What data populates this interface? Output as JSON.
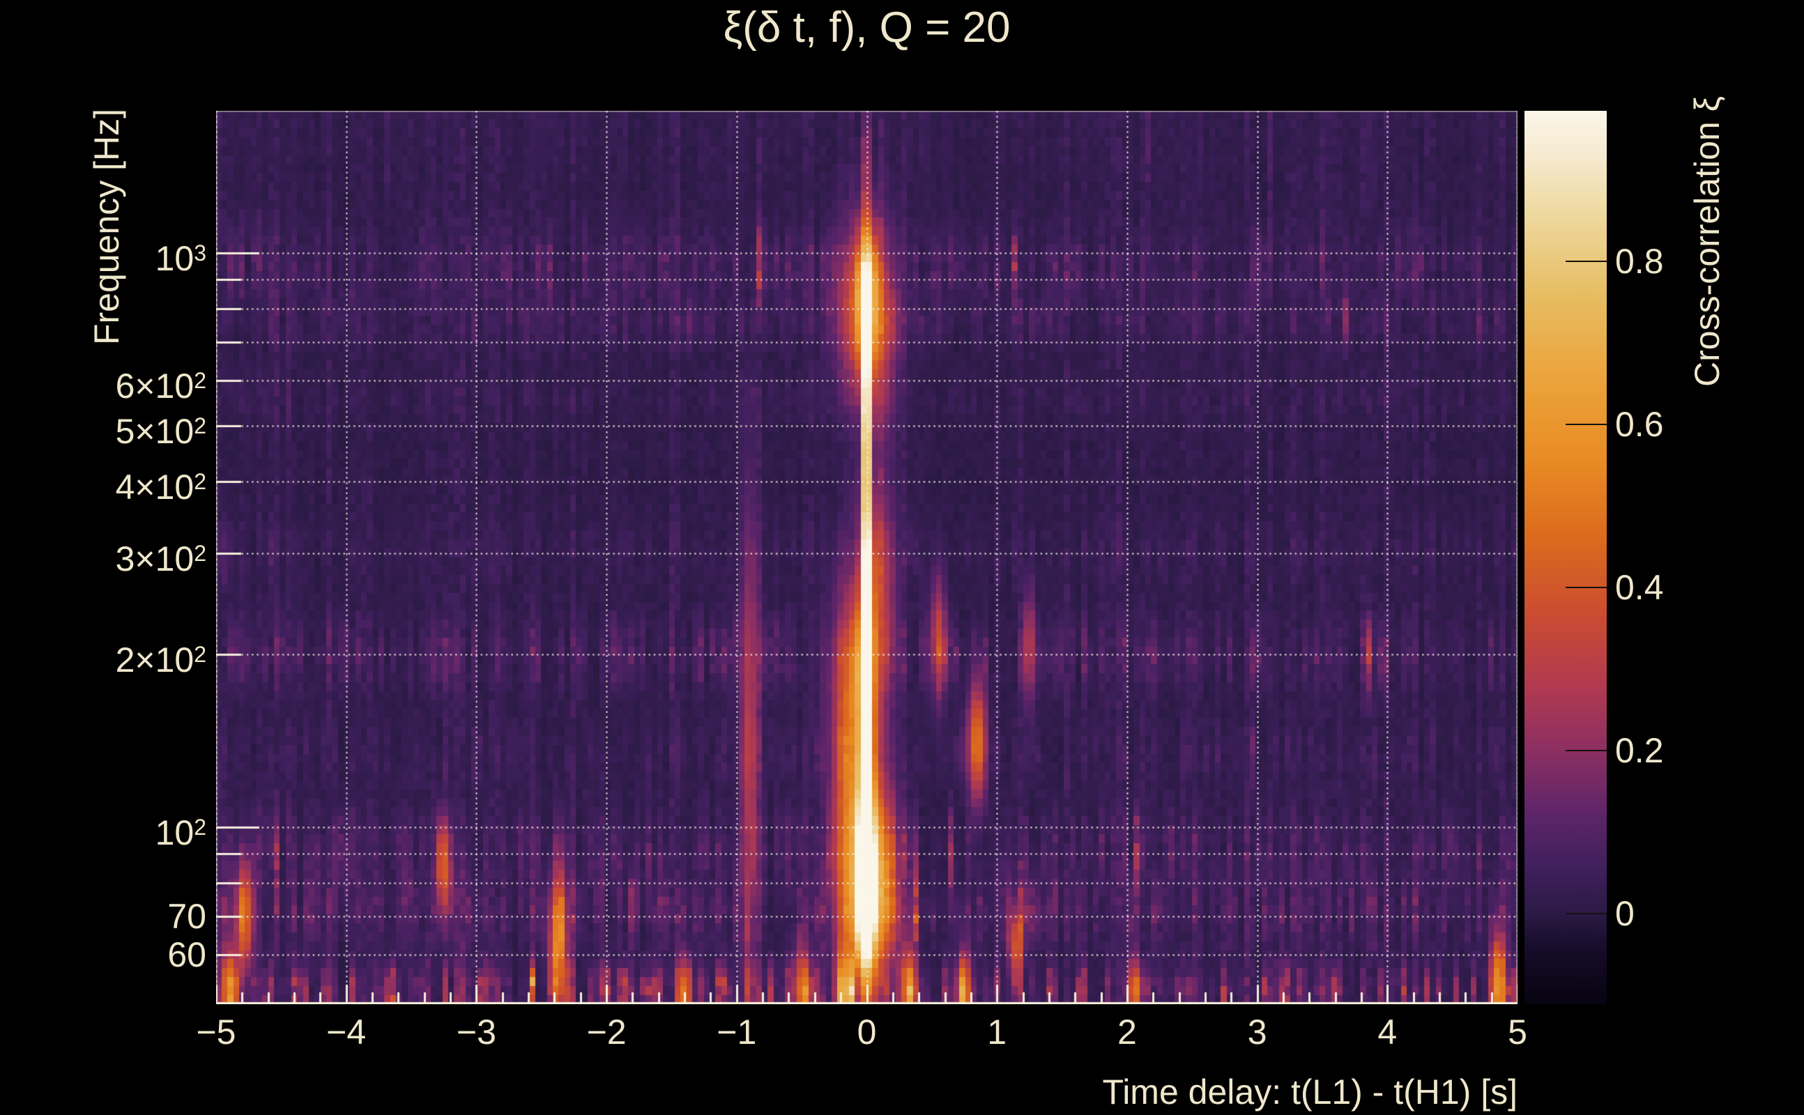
{
  "chart_data": {
    "type": "heatmap",
    "title": "ξ(δ t, f), Q = 20",
    "xlabel": "Time delay: t(L1) - t(H1) [s]",
    "ylabel": "Frequency [Hz]",
    "colorbar_label": "Cross-correlation ξ",
    "x_range": [
      -5,
      5
    ],
    "x_ticks": [
      {
        "v": -5,
        "label": "−5"
      },
      {
        "v": -4,
        "label": "−4"
      },
      {
        "v": -3,
        "label": "−3"
      },
      {
        "v": -2,
        "label": "−2"
      },
      {
        "v": -1,
        "label": "−1"
      },
      {
        "v": 0,
        "label": "0"
      },
      {
        "v": 1,
        "label": "1"
      },
      {
        "v": 2,
        "label": "2"
      },
      {
        "v": 3,
        "label": "3"
      },
      {
        "v": 4,
        "label": "4"
      },
      {
        "v": 5,
        "label": "5"
      }
    ],
    "x_minor_tick_step": 0.2,
    "y_scale": "log",
    "y_range_hz": [
      49.2,
      1768
    ],
    "y_ticks": [
      {
        "text": "10",
        "sup": "3",
        "f": 1000
      },
      {
        "text": "6×10",
        "sup": "2",
        "f": 600
      },
      {
        "text": "5×10",
        "sup": "2",
        "f": 500
      },
      {
        "text": "4×10",
        "sup": "2",
        "f": 400
      },
      {
        "text": "3×10",
        "sup": "2",
        "f": 300
      },
      {
        "text": "2×10",
        "sup": "2",
        "f": 200
      },
      {
        "text": "10",
        "sup": "2",
        "f": 100
      },
      {
        "text": "70",
        "sup": "",
        "f": 70
      },
      {
        "text": "60",
        "sup": "",
        "f": 60
      }
    ],
    "y_gridline_freqs": [
      1000,
      900,
      800,
      700,
      600,
      500,
      400,
      300,
      200,
      100,
      90,
      80,
      70,
      60
    ],
    "grid": "dotted",
    "colorbar": {
      "min": -0.111,
      "max": 0.985,
      "ticks": [
        {
          "v": 0.8,
          "label": "0.8"
        },
        {
          "v": 0.6,
          "label": "0.6"
        },
        {
          "v": 0.4,
          "label": "0.4"
        },
        {
          "v": 0.2,
          "label": "0.2"
        },
        {
          "v": 0.0,
          "label": "0"
        }
      ],
      "stops": [
        {
          "v": -0.111,
          "c": "#070310"
        },
        {
          "v": -0.04,
          "c": "#170d2c"
        },
        {
          "v": 0.0,
          "c": "#2b1a45"
        },
        {
          "v": 0.06,
          "c": "#41205e"
        },
        {
          "v": 0.12,
          "c": "#5c2469"
        },
        {
          "v": 0.2,
          "c": "#8c2f62"
        },
        {
          "v": 0.28,
          "c": "#b13a50"
        },
        {
          "v": 0.36,
          "c": "#c94a33"
        },
        {
          "v": 0.46,
          "c": "#dc6a1d"
        },
        {
          "v": 0.56,
          "c": "#e98c25"
        },
        {
          "v": 0.66,
          "c": "#eba43c"
        },
        {
          "v": 0.76,
          "c": "#e7bd63"
        },
        {
          "v": 0.86,
          "c": "#eed9a0"
        },
        {
          "v": 0.93,
          "c": "#f6ead0"
        },
        {
          "v": 0.985,
          "c": "#fbf6ea"
        }
      ]
    },
    "peak": {
      "time_delay_s": 0.0,
      "max_cross_correlation": 0.985,
      "freq_span_hz": [
        50,
        1600
      ]
    },
    "features": [
      {
        "t": 0.0,
        "f": 72,
        "a": 0.95,
        "dt": 0.055,
        "dl": 0.09
      },
      {
        "t": 0.0,
        "f": 100,
        "a": 0.9,
        "dt": 0.045,
        "dl": 0.1
      },
      {
        "t": 0.0,
        "f": 170,
        "a": 0.85,
        "dt": 0.035,
        "dl": 0.1
      },
      {
        "t": 0.0,
        "f": 270,
        "a": 0.8,
        "dt": 0.028,
        "dl": 0.1
      },
      {
        "t": 0.0,
        "f": 420,
        "a": 0.78,
        "dt": 0.022,
        "dl": 0.1
      },
      {
        "t": 0.0,
        "f": 560,
        "a": 0.72,
        "dt": 0.02,
        "dl": 0.08
      },
      {
        "t": 0.0,
        "f": 810,
        "a": 0.73,
        "dt": 0.045,
        "dl": 0.08
      },
      {
        "t": 0.0,
        "f": 1050,
        "a": 0.4,
        "dt": 0.015,
        "dl": 0.08
      },
      {
        "t": 0.0,
        "f": 1500,
        "a": 0.62,
        "dt": 0.012,
        "dl": 0.06
      },
      {
        "t": -0.12,
        "f": 90,
        "a": 0.5,
        "dt": 0.1,
        "dl": 0.16
      },
      {
        "t": 0.12,
        "f": 80,
        "a": 0.48,
        "dt": 0.09,
        "dl": 0.12
      },
      {
        "t": -0.1,
        "f": 180,
        "a": 0.35,
        "dt": 0.12,
        "dl": 0.12
      },
      {
        "t": 0.08,
        "f": 250,
        "a": 0.3,
        "dt": 0.1,
        "dl": 0.15
      },
      {
        "t": -0.08,
        "f": 800,
        "a": 0.32,
        "dt": 0.12,
        "dl": 0.1
      },
      {
        "t": 0.1,
        "f": 750,
        "a": 0.28,
        "dt": 0.1,
        "dl": 0.12
      },
      {
        "t": -0.9,
        "f": 140,
        "a": 0.28,
        "dt": 0.05,
        "dl": 0.3
      },
      {
        "t": -4.78,
        "f": 70,
        "a": 0.45,
        "dt": 0.05,
        "dl": 0.07
      },
      {
        "t": -3.25,
        "f": 85,
        "a": 0.4,
        "dt": 0.04,
        "dl": 0.06
      },
      {
        "t": -2.37,
        "f": 64,
        "a": 0.52,
        "dt": 0.05,
        "dl": 0.08
      },
      {
        "t": 0.85,
        "f": 140,
        "a": 0.5,
        "dt": 0.05,
        "dl": 0.07
      },
      {
        "t": 0.55,
        "f": 215,
        "a": 0.3,
        "dt": 0.04,
        "dl": 0.08
      },
      {
        "t": 1.25,
        "f": 205,
        "a": 0.32,
        "dt": 0.03,
        "dl": 0.07
      },
      {
        "t": 0.32,
        "f": 52,
        "a": 0.5,
        "dt": 0.04,
        "dl": 0.05
      },
      {
        "t": 0.75,
        "f": 51,
        "a": 0.55,
        "dt": 0.04,
        "dl": 0.05
      },
      {
        "t": 4.85,
        "f": 54,
        "a": 0.5,
        "dt": 0.04,
        "dl": 0.06
      },
      {
        "t": -0.5,
        "f": 52,
        "a": 0.45,
        "dt": 0.05,
        "dl": 0.05
      },
      {
        "t": -0.18,
        "f": 51,
        "a": 0.5,
        "dt": 0.04,
        "dl": 0.05
      },
      {
        "t": 1.15,
        "f": 62,
        "a": 0.35,
        "dt": 0.04,
        "dl": 0.05
      },
      {
        "t": -4.9,
        "f": 52,
        "a": 0.4,
        "dt": 0.05,
        "dl": 0.05
      },
      {
        "t": 2.05,
        "f": 52,
        "a": 0.35,
        "dt": 0.04,
        "dl": 0.04
      },
      {
        "t": -1.4,
        "f": 52,
        "a": 0.35,
        "dt": 0.04,
        "dl": 0.04
      }
    ],
    "noise_bands": [
      {
        "f": 1600,
        "s": 0.035,
        "w": 0.1
      },
      {
        "f": 950,
        "s": 0.13,
        "w": 0.045
      },
      {
        "f": 760,
        "s": 0.09,
        "w": 0.035
      },
      {
        "f": 560,
        "s": 0.05,
        "w": 0.03
      },
      {
        "f": 300,
        "s": 0.05,
        "w": 0.04
      },
      {
        "f": 200,
        "s": 0.15,
        "w": 0.045
      },
      {
        "f": 135,
        "s": 0.08,
        "w": 0.04
      },
      {
        "f": 92,
        "s": 0.13,
        "w": 0.05
      },
      {
        "f": 71,
        "s": 0.16,
        "w": 0.045
      },
      {
        "f": 52,
        "s": 0.34,
        "w": 0.033
      }
    ],
    "render": {
      "nt": 224,
      "nf": 100,
      "seed": 20150914
    }
  },
  "colors": {
    "background": "#000000",
    "text": "#efe7cb",
    "grid": "#f5efdc"
  }
}
